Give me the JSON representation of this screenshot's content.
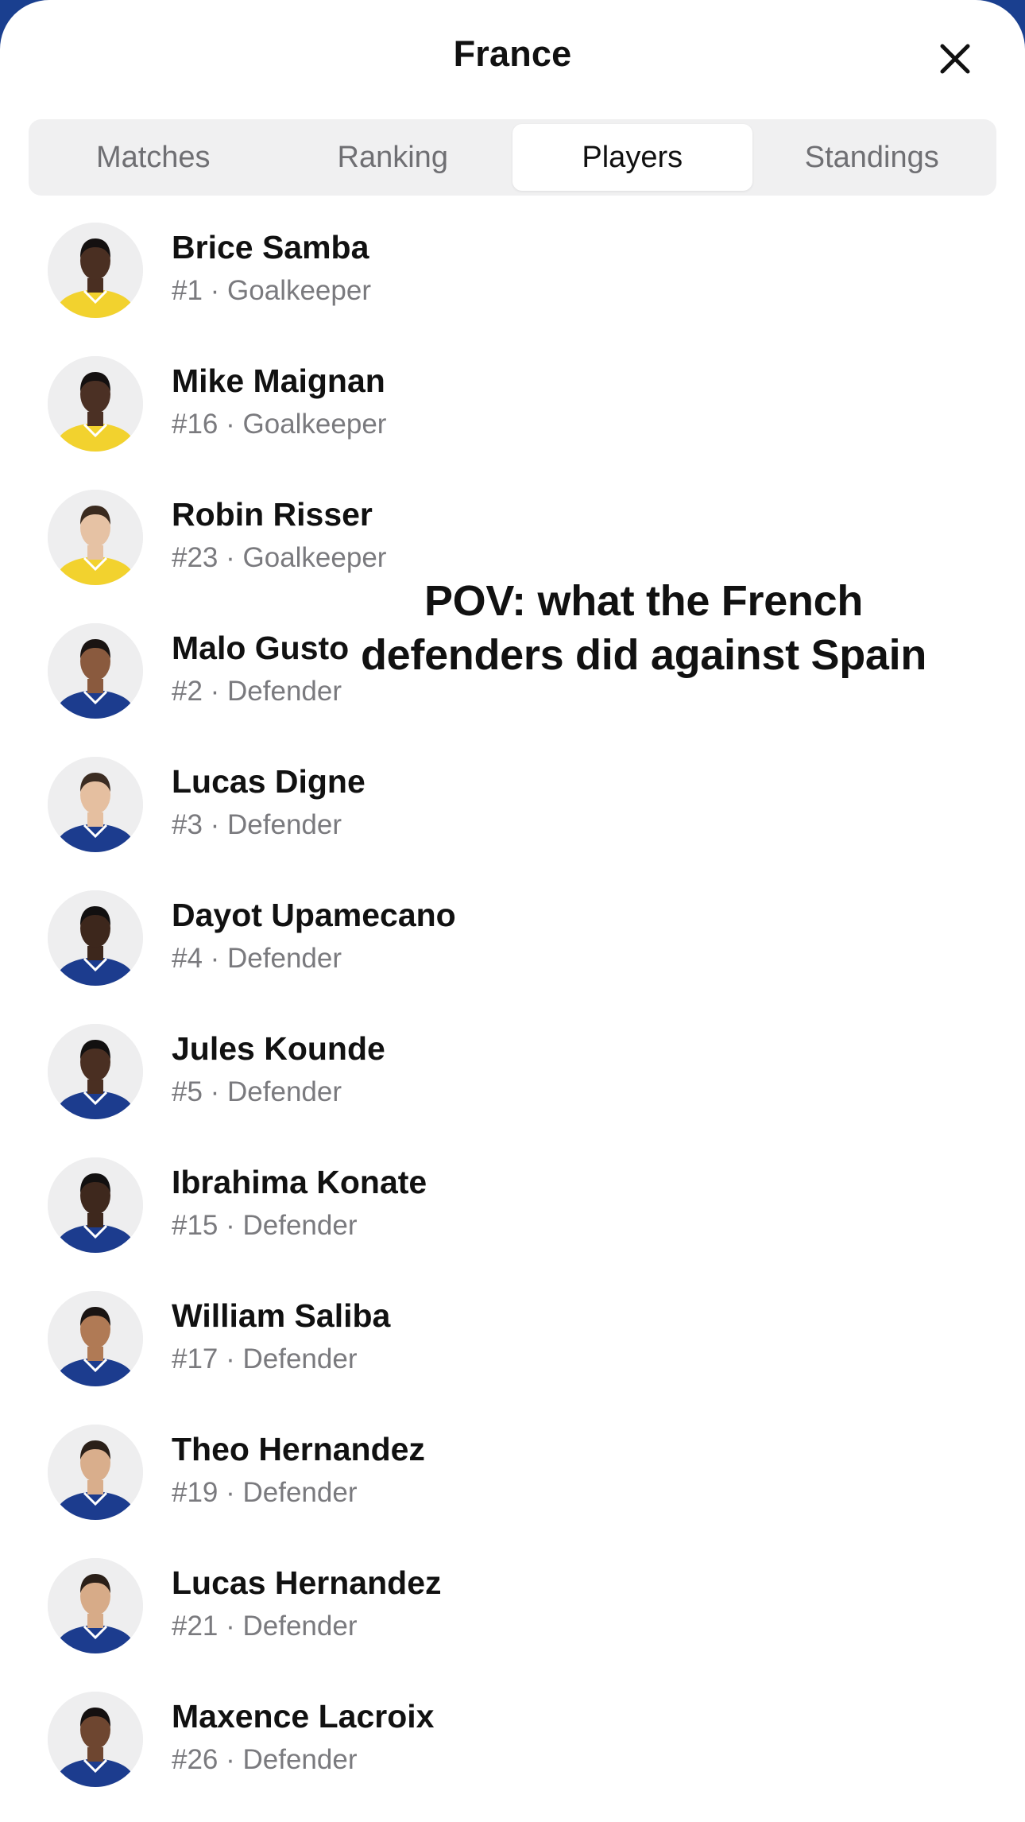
{
  "header": {
    "title": "France"
  },
  "tabs": [
    {
      "label": "Matches",
      "active": false
    },
    {
      "label": "Ranking",
      "active": false
    },
    {
      "label": "Players",
      "active": true
    },
    {
      "label": "Standings",
      "active": false
    }
  ],
  "players": [
    {
      "name": "Brice Samba",
      "meta": "#1 · Goalkeeper",
      "kit": "yellow",
      "skin": "#4a2f22",
      "hair": "#141010"
    },
    {
      "name": "Mike Maignan",
      "meta": "#16 · Goalkeeper",
      "kit": "yellow",
      "skin": "#4b3024",
      "hair": "#141010"
    },
    {
      "name": "Robin Risser",
      "meta": "#23 · Goalkeeper",
      "kit": "yellow",
      "skin": "#e6c2a4",
      "hair": "#3a2a1e"
    },
    {
      "name": "Malo Gusto",
      "meta": "#2 · Defender",
      "kit": "blue",
      "skin": "#8a5a3e",
      "hair": "#1a1412"
    },
    {
      "name": "Lucas Digne",
      "meta": "#3 · Defender",
      "kit": "blue",
      "skin": "#e5bfa0",
      "hair": "#3b2c22"
    },
    {
      "name": "Dayot Upamecano",
      "meta": "#4 · Defender",
      "kit": "blue",
      "skin": "#3d271c",
      "hair": "#121010"
    },
    {
      "name": "Jules Kounde",
      "meta": "#5 · Defender",
      "kit": "blue",
      "skin": "#4a2f22",
      "hair": "#121010"
    },
    {
      "name": "Ibrahima Konate",
      "meta": "#15 · Defender",
      "kit": "blue",
      "skin": "#3e281d",
      "hair": "#121010"
    },
    {
      "name": "William Saliba",
      "meta": "#17 · Defender",
      "kit": "blue",
      "skin": "#b07a55",
      "hair": "#1a1412"
    },
    {
      "name": "Theo Hernandez",
      "meta": "#19 · Defender",
      "kit": "blue",
      "skin": "#d9ae8c",
      "hair": "#2a1f18"
    },
    {
      "name": "Lucas Hernandez",
      "meta": "#21 · Defender",
      "kit": "blue",
      "skin": "#d7ab88",
      "hair": "#2a1f18"
    },
    {
      "name": "Maxence Lacroix",
      "meta": "#26 · Defender",
      "kit": "blue",
      "skin": "#6e4630",
      "hair": "#141010"
    }
  ],
  "overlay": {
    "line1": "POV: what the French",
    "line2": "defenders did against Spain"
  },
  "colors": {
    "kit_yellow": "#f2d22e",
    "kit_blue": "#1c3c8e",
    "accent_background": "#1a3f8f"
  }
}
